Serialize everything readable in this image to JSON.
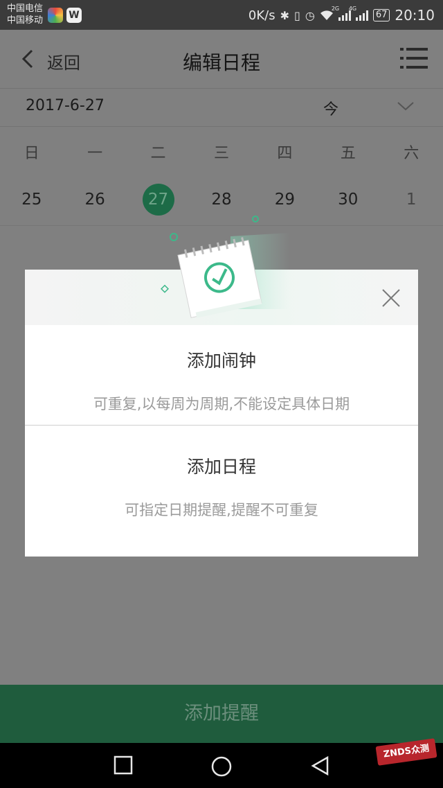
{
  "status_bar": {
    "carrier_1": "中国电信",
    "carrier_2": "中国移动",
    "app_badge_2": "W",
    "net_speed": "0K/s",
    "sim1_tag": "2G",
    "sim2_tag": "4G",
    "battery": "67",
    "time": "20:10"
  },
  "header": {
    "back_label": "返回",
    "title": "编辑日程"
  },
  "date_bar": {
    "date": "2017-6-27",
    "today_label": "今"
  },
  "calendar": {
    "weekdays": [
      "日",
      "一",
      "二",
      "三",
      "四",
      "五",
      "六"
    ],
    "days": [
      "25",
      "26",
      "27",
      "28",
      "29",
      "30",
      "1"
    ],
    "selected_day": "27"
  },
  "bottom_button": {
    "label": "添加提醒"
  },
  "dialog": {
    "option_1": {
      "title": "添加闹钟",
      "subtitle": "可重复,以每周为周期,不能设定具体日期"
    },
    "option_2": {
      "title": "添加日程",
      "subtitle": "可指定日期提醒,提醒不可重复"
    },
    "accent_color": "#3cb98a"
  },
  "watermark": {
    "text": "ZNDS众测"
  },
  "colors": {
    "overlay_gray": "#808080",
    "cta_green": "#1f5c3d",
    "selected_day_green": "#1d6b47"
  }
}
